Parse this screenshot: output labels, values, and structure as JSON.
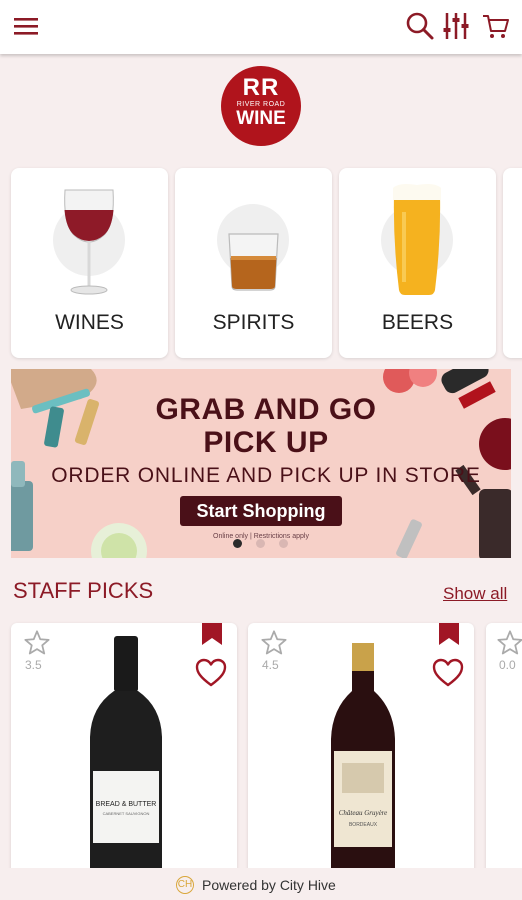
{
  "header": {
    "menu_icon": "hamburger-menu-icon",
    "search_icon": "search-icon",
    "filter_icon": "filter-sliders-icon",
    "cart_icon": "shopping-cart-icon"
  },
  "logo": {
    "line1": "RR",
    "line2": "RIVER ROAD",
    "line3": "WINE"
  },
  "categories": [
    {
      "label": "WINES",
      "icon": "wine-glass"
    },
    {
      "label": "SPIRITS",
      "icon": "whiskey-glass"
    },
    {
      "label": "BEERS",
      "icon": "beer-glass"
    }
  ],
  "banner": {
    "title_line1": "GRAB AND GO",
    "title_line2": "PICK UP",
    "subtitle": "ORDER ONLINE AND PICK UP IN STORE",
    "button_label": "Start Shopping",
    "fine_print": "Online only | Restrictions apply",
    "slides": 3,
    "active_slide": 0
  },
  "staff_picks": {
    "title": "STAFF PICKS",
    "show_all": "Show all",
    "products": [
      {
        "rating": "3.5",
        "label_line1": "BREAD & BUTTER",
        "label_line2": "CABERNET SAUVIGNON"
      },
      {
        "rating": "4.5",
        "label_line1": "Château Gruyère",
        "label_line2": "BORDEAUX"
      },
      {
        "rating": "0.0"
      }
    ]
  },
  "footer": {
    "text": "Powered by City Hive"
  },
  "colors": {
    "brand": "#8c1a26",
    "logo": "#b0141c",
    "background": "#f7eeee",
    "banner": "#f6d0c8"
  }
}
